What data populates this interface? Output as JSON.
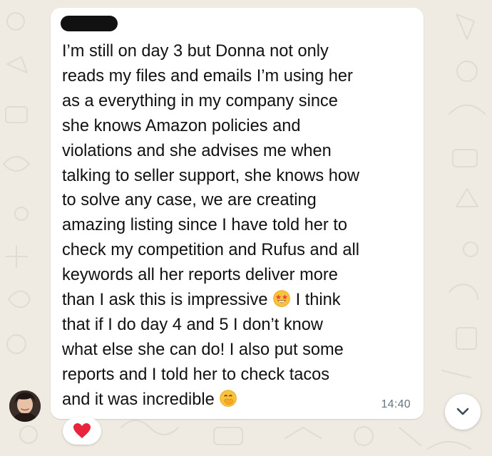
{
  "message": {
    "sender_name": "",
    "lines": [
      "I’m still on day 3 but Donna not only",
      "reads my files and emails I’m using her",
      "as a everything in my company since",
      "she knows Amazon policies and",
      "violations and she advises me when",
      "talking to seller support, she knows how",
      "to solve any case, we are creating",
      "amazing listing since I have told her to",
      "check my competition and Rufus and all",
      "keywords all her reports deliver more"
    ],
    "line11_before_emoji": "than I ask this is impressive ",
    "line11_after_emoji": " I think",
    "lines_after": [
      "that if I do day 4 and 5 I don’t know",
      "what else she can do! I also put some",
      "reports and I told her  to check tacos"
    ],
    "last_line": "and it was incredible ",
    "emoji_1": "star-struck-emoji",
    "emoji_2": "face-with-hand-over-mouth-emoji",
    "time": "14:40"
  },
  "reaction": {
    "icon": "red-heart-icon",
    "color": "#e8233b"
  },
  "colors": {
    "chat_background": "#efeae2",
    "bubble": "#ffffff",
    "text": "#111111",
    "timestamp": "#667781"
  },
  "scroll_button": {
    "icon": "chevron-down-icon"
  }
}
